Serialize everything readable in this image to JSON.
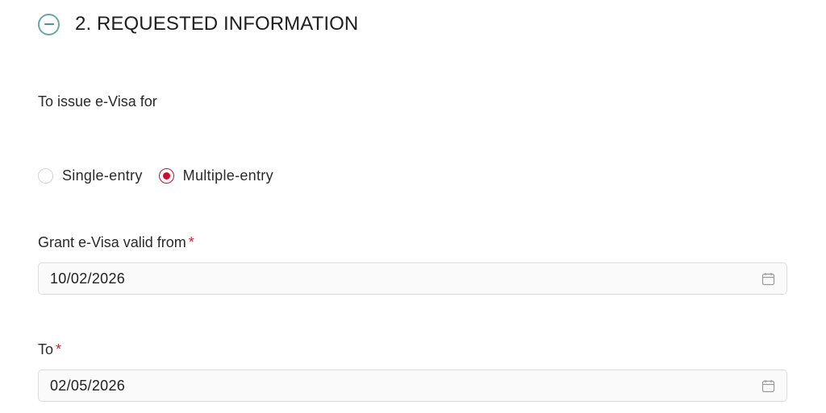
{
  "section": {
    "title": "2. REQUESTED INFORMATION",
    "toggle_icon": "minus-circle-icon"
  },
  "question": {
    "label": "To issue e-Visa for"
  },
  "entry_options": [
    {
      "label": "Single-entry",
      "selected": false
    },
    {
      "label": "Multiple-entry",
      "selected": true
    }
  ],
  "valid_from": {
    "label": "Grant e-Visa valid from",
    "required_mark": "*",
    "value": "10/02/2026",
    "icon": "calendar-icon"
  },
  "valid_to": {
    "label": "To",
    "required_mark": "*",
    "value": "02/05/2026",
    "icon": "calendar-icon"
  },
  "colors": {
    "accent": "#c8102e",
    "toggle": "#6aa6ad",
    "required": "#d3202c"
  }
}
